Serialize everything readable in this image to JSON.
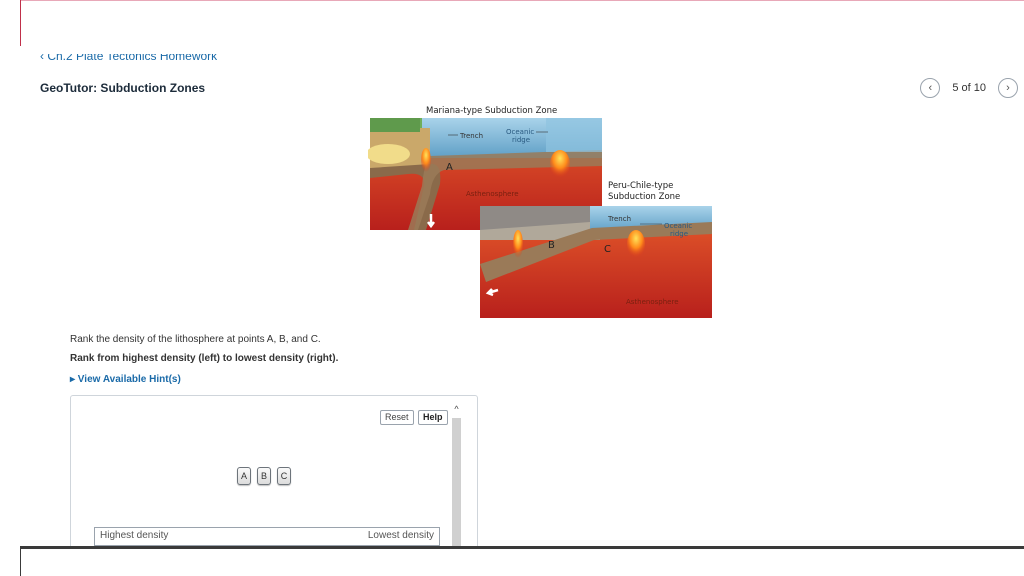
{
  "header": {
    "breadcrumb": "‹ Ch.2 Plate Tectonics Homework",
    "title": "GeoTutor: Subduction Zones"
  },
  "pager": {
    "prev_icon": "chevron-left-icon",
    "next_icon": "chevron-right-icon",
    "text": "5 of 10"
  },
  "figure": {
    "title_top": "Mariana-type Subduction Zone",
    "trench1": "Trench",
    "oceanic_ridge1_line1": "Oceanic",
    "oceanic_ridge1_line2": "ridge",
    "asthenosphere1": "Asthenosphere",
    "point_a": "A",
    "title_bottom_line1": "Peru-Chile-type",
    "title_bottom_line2": "Subduction Zone",
    "trench2": "Trench",
    "oceanic_ridge2_line1": "Oceanic",
    "oceanic_ridge2_line2": "ridge",
    "asthenosphere2": "Asthenosphere",
    "point_b": "B",
    "point_c": "C"
  },
  "question": {
    "line1": "Rank the density of the lithosphere at points A, B, and C.",
    "line2": "Rank from highest density (left) to lowest density (right).",
    "hint_link": "▸ View Available Hint(s)"
  },
  "panel": {
    "reset_label": "Reset",
    "help_label": "Help",
    "scroll_up": "^",
    "tiles": [
      "A",
      "B",
      "C"
    ],
    "rank_left": "Highest density",
    "rank_right": "Lowest density"
  },
  "colors": {
    "accent": "#1a6aa8",
    "mantle": "#c8341c",
    "ocean": "#7fb8d8"
  }
}
